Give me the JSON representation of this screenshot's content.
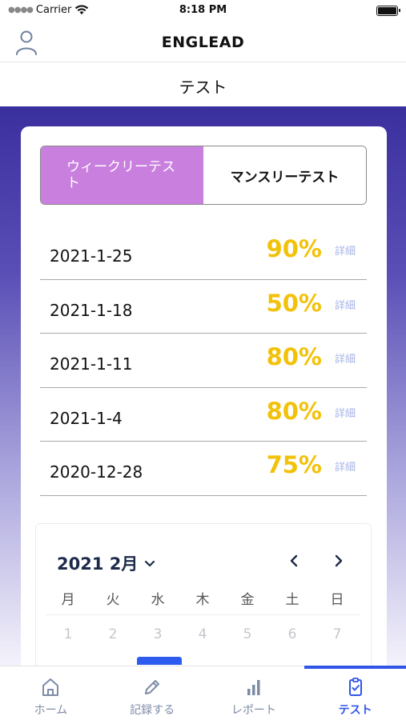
{
  "status": {
    "carrier": "Carrier",
    "time": "8:18 PM"
  },
  "header": {
    "title": "ENGLEAD",
    "profile_icon": "person-icon"
  },
  "page": {
    "title": "テスト"
  },
  "segment": {
    "active_label": "ウィークリーテスト",
    "inactive_label": "マンスリーテスト"
  },
  "results": [
    {
      "date": "2021-1-25",
      "score": "90%",
      "detail": "詳細"
    },
    {
      "date": "2021-1-18",
      "score": "50%",
      "detail": "詳細"
    },
    {
      "date": "2021-1-11",
      "score": "80%",
      "detail": "詳細"
    },
    {
      "date": "2021-1-4",
      "score": "80%",
      "detail": "詳細"
    },
    {
      "date": "2020-12-28",
      "score": "75%",
      "detail": "詳細"
    }
  ],
  "calendar": {
    "month_label": "2021 2月",
    "weekdays": [
      "月",
      "火",
      "水",
      "木",
      "金",
      "土",
      "日"
    ],
    "days": [
      "1",
      "2",
      "3",
      "4",
      "5",
      "6",
      "7"
    ]
  },
  "tabs": [
    {
      "label": "ホーム",
      "icon": "home-icon"
    },
    {
      "label": "記録する",
      "icon": "pencil-icon"
    },
    {
      "label": "レポート",
      "icon": "bar-chart-icon"
    },
    {
      "label": "テスト",
      "icon": "clipboard-check-icon"
    }
  ],
  "colors": {
    "accent": "#3056e8",
    "segment_active": "#c97fde",
    "score": "#f2c20a",
    "detail": "#a9b4e6",
    "gradient_top": "#3a2f9e"
  }
}
